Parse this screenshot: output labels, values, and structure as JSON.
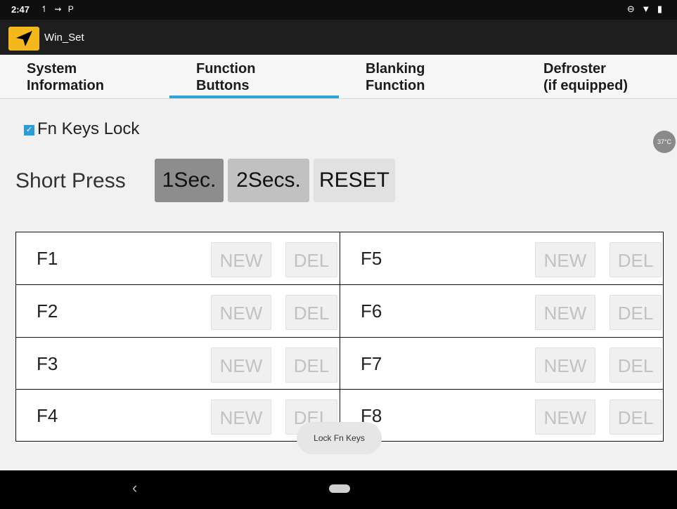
{
  "status_bar": {
    "time": "2:47",
    "left_icons": "↿ ⇝ P",
    "right_icons": "⊖ ▼ ▮"
  },
  "app": {
    "title": "Win_Set",
    "icon": "navigation-arrow-icon",
    "accent": "#f4b81c"
  },
  "tabs": [
    {
      "label": "System\nInformation",
      "active": false
    },
    {
      "label": "Function\nButtons",
      "active": true
    },
    {
      "label": "Blanking\nFunction",
      "active": false
    },
    {
      "label": "Defroster\n(if equipped)",
      "active": false
    }
  ],
  "fn_lock": {
    "label": "Fn Keys Lock",
    "checked": true
  },
  "temperature": "37°C",
  "short_press": {
    "label": "Short Press",
    "options": [
      "1Sec.",
      "2Secs.",
      "RESET"
    ],
    "selected": "1Sec."
  },
  "fn_keys": [
    {
      "name": "F1",
      "new": "NEW",
      "del": "DEL"
    },
    {
      "name": "F2",
      "new": "NEW",
      "del": "DEL"
    },
    {
      "name": "F3",
      "new": "NEW",
      "del": "DEL"
    },
    {
      "name": "F4",
      "new": "NEW",
      "del": "DEL"
    },
    {
      "name": "F5",
      "new": "NEW",
      "del": "DEL"
    },
    {
      "name": "F6",
      "new": "NEW",
      "del": "DEL"
    },
    {
      "name": "F7",
      "new": "NEW",
      "del": "DEL"
    },
    {
      "name": "F8",
      "new": "NEW",
      "del": "DEL"
    }
  ],
  "toast": "Lock Fn Keys",
  "nav": {
    "back": "‹"
  },
  "colors": {
    "tab_indicator": "#2fa4d8",
    "checkbox": "#2f9bd6"
  }
}
